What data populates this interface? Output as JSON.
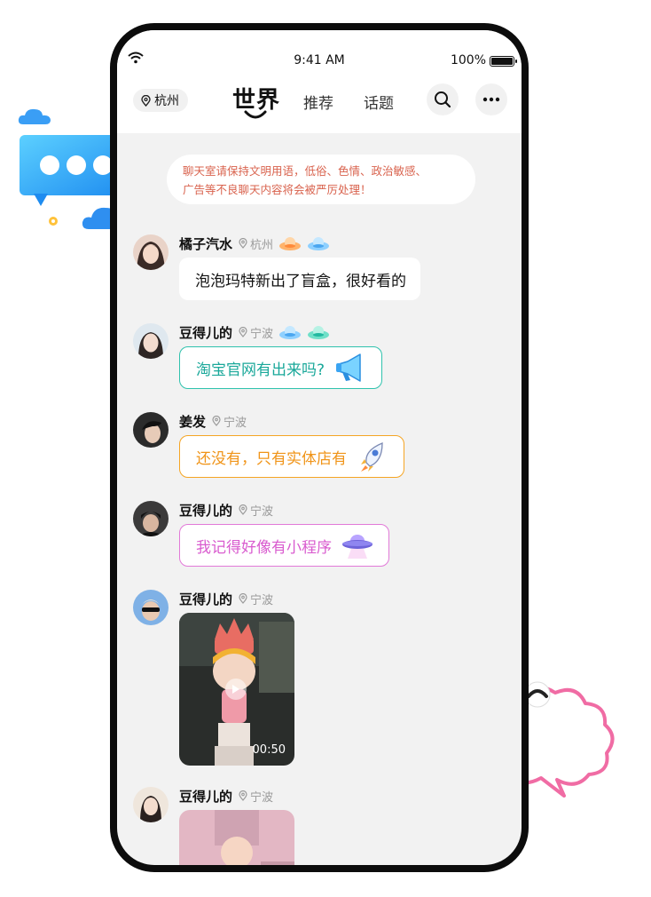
{
  "status": {
    "time": "9:41 AM",
    "battery": "100%",
    "battery_level": 1.0
  },
  "nav": {
    "location": "杭州",
    "tabs": [
      {
        "label": "世界",
        "active": true
      },
      {
        "label": "推荐"
      },
      {
        "label": "话题"
      }
    ],
    "icons": [
      "search-icon",
      "more-icon"
    ]
  },
  "notice": {
    "line1": "聊天室请保持文明用语，低俗、色情、政治敏感、",
    "line2": "广告等不良聊天内容将会被严厉处理！"
  },
  "messages": [
    {
      "user": "橘子汽水",
      "city": "杭州",
      "badges": [
        "orange-ufo-badge",
        "blue-ufo-badge"
      ],
      "text": "泡泡玛特新出了盲盒，很好看的",
      "style": "plain"
    },
    {
      "user": "豆得儿的",
      "city": "宁波",
      "badges": [
        "blue-ufo-badge",
        "teal-ufo-badge"
      ],
      "text": "淘宝官网有出来吗?",
      "style": "teal",
      "emoji": "megaphone-icon"
    },
    {
      "user": "姜发",
      "city": "宁波",
      "text": "还没有，只有实体店有",
      "style": "orange",
      "emoji": "rocket-icon"
    },
    {
      "user": "豆得儿的",
      "city": "宁波",
      "text": "我记得好像有小程序",
      "style": "pink",
      "emoji": "ufo-icon"
    },
    {
      "user": "豆得儿的",
      "city": "宁波",
      "video_duration": "00:50",
      "style": "video"
    },
    {
      "user": "豆得儿的",
      "city": "宁波",
      "style": "image"
    }
  ],
  "colors": {
    "teal": "#2fc2ad",
    "orange": "#f5a524",
    "pink": "#e27ad8",
    "notice": "#d9634e",
    "accent_blue": "#3db9f5"
  }
}
